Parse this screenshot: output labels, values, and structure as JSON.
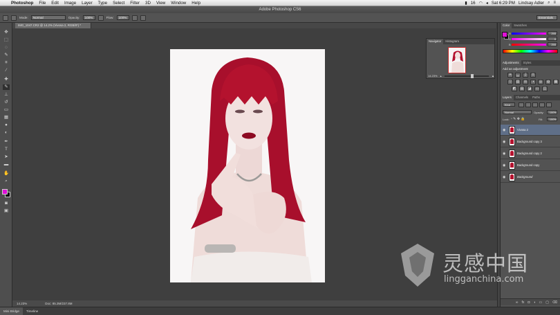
{
  "menubar": {
    "app": "Photoshop",
    "items": [
      "File",
      "Edit",
      "Image",
      "Layer",
      "Type",
      "Select",
      "Filter",
      "3D",
      "View",
      "Window",
      "Help"
    ],
    "battery": "16",
    "clock": "Sat 6:29 PM",
    "user": "Lindsay Adler"
  },
  "titlebar": {
    "title": "Adobe Photoshop CS6"
  },
  "options": {
    "mode_label": "Mode:",
    "mode_value": "Normal",
    "opacity_label": "Opacity:",
    "opacity_value": "100%",
    "flow_label": "Flow:",
    "flow_value": "100%",
    "workspace": "Essentials"
  },
  "document": {
    "tab_title": "IMG_1047.CR2 @ 14.2% (Vivosa 2, RGB/8*) *",
    "zoom": "14.23%",
    "doc_size": "Doc: 85.3M/237.8M"
  },
  "navigator": {
    "tabs": [
      "Navigator",
      "Histogram"
    ],
    "zoom": "14.23%"
  },
  "color_panel": {
    "tabs": [
      "Color",
      "Swatches"
    ],
    "rows": [
      {
        "label": "R",
        "value": "255"
      },
      {
        "label": "G",
        "value": "0"
      },
      {
        "label": "B",
        "value": "255"
      }
    ],
    "foreground": "#e010d8"
  },
  "adjustments_panel": {
    "tabs": [
      "Adjustments",
      "Styles"
    ],
    "heading": "Add an adjustment"
  },
  "layers_panel": {
    "tabs": [
      "Layers",
      "Channels",
      "Paths"
    ],
    "kind": "Kind",
    "blend_mode": "Normal",
    "opacity_label": "Opacity:",
    "opacity_value": "100%",
    "lock_label": "Lock:",
    "fill_label": "Fill:",
    "fill_value": "100%",
    "layers": [
      {
        "name": "Vivosa 2",
        "selected": true
      },
      {
        "name": "Background copy 3",
        "selected": false
      },
      {
        "name": "Background copy 2",
        "selected": false
      },
      {
        "name": "Background copy",
        "selected": false
      },
      {
        "name": "Background",
        "selected": false
      }
    ]
  },
  "bottom_tabs": [
    "Mini Bridge",
    "Timeline"
  ],
  "watermark": {
    "cn": "灵感中国",
    "url": "lingganchina.com"
  },
  "colors": {
    "hair": "#b4122e",
    "selection": "#5f6f88",
    "accent": "#e010d8"
  }
}
